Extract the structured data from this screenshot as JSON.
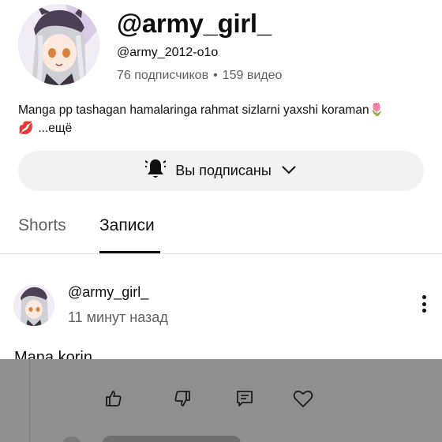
{
  "channel": {
    "name": "@army_girl_",
    "handle": "@army_2012-o1o",
    "subscribers": "76 подписчиков",
    "separator": "•",
    "videos": "159 видео",
    "description_line1": "Manga pp tashagan hamalaringa rahmat sizlarni yaxshi koraman",
    "description_emoji1": "🌷",
    "description_emoji2": "💋",
    "description_more": "...ещё"
  },
  "subscribe_button": {
    "label": "Вы подписаны",
    "bell_icon": "bell-icon",
    "dropdown_icon": "chevron-down-icon"
  },
  "tabs": [
    {
      "label": "Shorts",
      "active": false
    },
    {
      "label": "Записи",
      "active": true
    }
  ],
  "post": {
    "author": "@army_girl_",
    "time": "11 минут назад",
    "text": "Mana korin",
    "menu_icon": "more-vertical-icon",
    "actions": [
      "like-icon",
      "dislike-icon",
      "comment-icon",
      "heart-icon"
    ]
  }
}
